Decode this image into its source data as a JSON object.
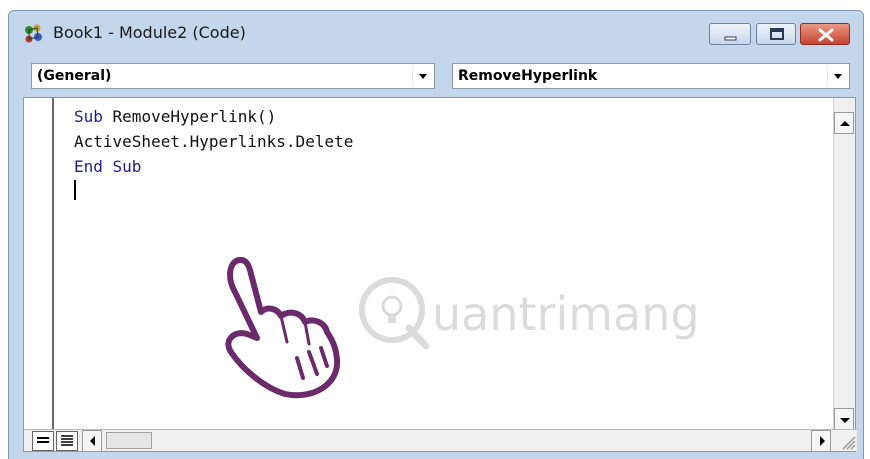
{
  "window": {
    "title": "Book1 - Module2 (Code)",
    "app_icon": "vba-project-icon",
    "controls": [
      "minimize-icon",
      "maximize-icon",
      "close-icon"
    ]
  },
  "object_combo": {
    "value": "(General)"
  },
  "procedure_combo": {
    "value": "RemoveHyperlink"
  },
  "code": {
    "lines": [
      {
        "keyword": "Sub",
        "rest": " RemoveHyperlink()"
      },
      {
        "keyword": "",
        "rest": "ActiveSheet.Hyperlinks.Delete"
      },
      {
        "keyword": "End Sub",
        "rest": ""
      }
    ]
  },
  "watermark": {
    "text": "uantrimang"
  },
  "colors": {
    "keyword": "#1d1d8f",
    "titlebar": "#c4d6ec",
    "close_button": "#c84431",
    "pointer_outline": "#6b2a6b"
  }
}
